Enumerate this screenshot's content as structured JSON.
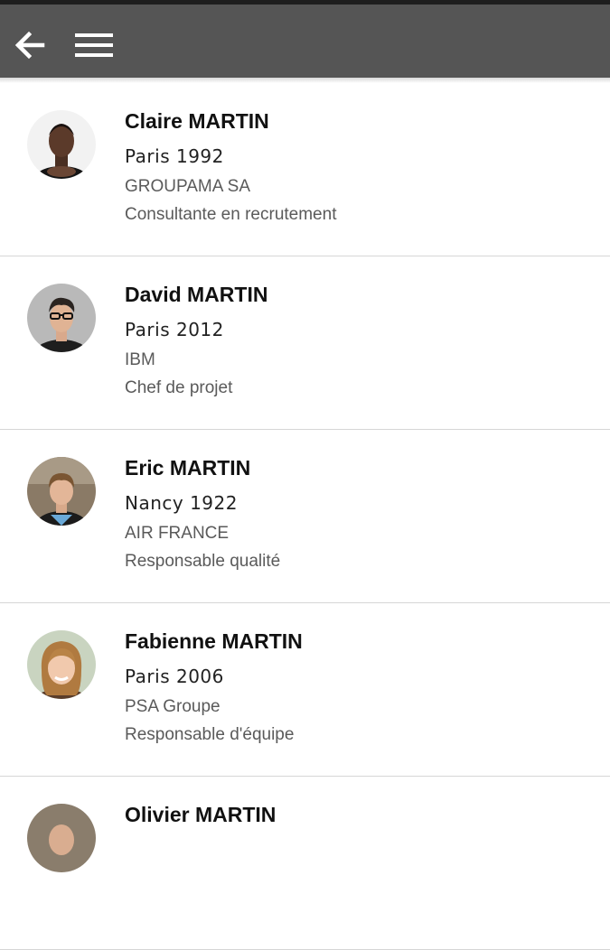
{
  "header": {
    "back_icon": "arrow-left-icon",
    "menu_icon": "hamburger-menu-icon",
    "background": "#555555"
  },
  "people": [
    {
      "name": "Claire MARTIN",
      "location": "Paris 1992",
      "company": "GROUPAMA SA",
      "job": "Consultante en recrutement"
    },
    {
      "name": "David MARTIN",
      "location": "Paris 2012",
      "company": "IBM",
      "job": "Chef de projet"
    },
    {
      "name": "Eric MARTIN",
      "location": "Nancy 1922",
      "company": "AIR FRANCE",
      "job": "Responsable qualité"
    },
    {
      "name": "Fabienne MARTIN",
      "location": "Paris 2006",
      "company": "PSA Groupe",
      "job": "Responsable d'équipe"
    },
    {
      "name": "Olivier MARTIN",
      "location": "",
      "company": "",
      "job": ""
    }
  ]
}
